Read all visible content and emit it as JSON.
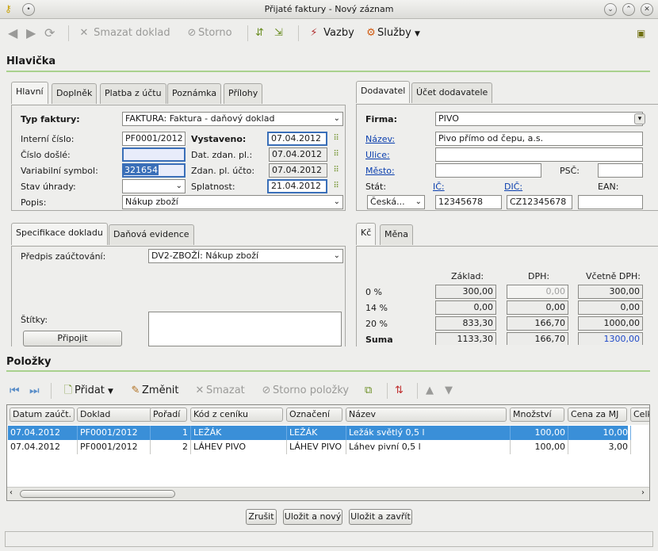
{
  "window": {
    "title": "Přijaté faktury - Nový záznam"
  },
  "toolbar": {
    "delete": "Smazat doklad",
    "storno": "Storno",
    "vazby": "Vazby",
    "sluzby": "Služby"
  },
  "header": {
    "title": "Hlavička",
    "tabs_left": [
      "Hlavní",
      "Doplněk",
      "Platba z účtu",
      "Poznámka",
      "Přílohy"
    ],
    "tabs_right": [
      "Dodavatel",
      "Účet dodavatele"
    ],
    "typ_faktury_label": "Typ faktury:",
    "typ_faktury_value": "FAKTURA: Faktura - daňový doklad",
    "interni_cislo_label": "Interní číslo:",
    "interni_cislo_value": "PF0001/2012",
    "cislo_dosle_label": "Číslo došlé:",
    "cislo_dosle_value": "",
    "variabilni_symbol_label": "Variabilní symbol:",
    "variabilni_symbol_value": "321654",
    "stav_uhrady_label": "Stav úhrady:",
    "stav_uhrady_value": "",
    "popis_label": "Popis:",
    "popis_value": "Nákup zboží",
    "vystaveno_label": "Vystaveno:",
    "vystaveno_value": "07.04.2012",
    "dat_zdan_label": "Dat. zdan. pl.:",
    "dat_zdan_value": "07.04.2012",
    "zdan_ucto_label": "Zdan. pl. účto:",
    "zdan_ucto_value": "07.04.2012",
    "splatnost_label": "Splatnost:",
    "splatnost_value": "21.04.2012"
  },
  "supplier": {
    "firma_label": "Firma:",
    "firma_value": "PIVO",
    "nazev_label": "Název:",
    "nazev_value": "Pivo přímo od čepu, a.s.",
    "ulice_label": "Ulice:",
    "ulice_value": "",
    "mesto_label": "Město:",
    "mesto_value": "",
    "psc_label": "PSČ:",
    "psc_value": "",
    "stat_label": "Stát:",
    "stat_value": "Česká...",
    "ic_label": "IČ:",
    "ic_value": "12345678",
    "dic_label": "DIČ:",
    "dic_value": "CZ12345678",
    "ean_label": "EAN:",
    "ean_value": ""
  },
  "spec": {
    "tabs": [
      "Specifikace dokladu",
      "Daňová evidence"
    ],
    "predpis_label": "Předpis zaúčtování:",
    "predpis_value": "DV2-ZBOŽÍ: Nákup zboží",
    "stitky_label": "Štítky:",
    "pripojit": "Připojit"
  },
  "vat": {
    "tabs": [
      "Kč",
      "Měna"
    ],
    "col_zaklad": "Základ:",
    "col_dph": "DPH:",
    "col_vcetne": "Včetně DPH:",
    "rows": [
      {
        "label": "0 %",
        "zaklad": "300,00",
        "dph": "0,00",
        "vcetne": "300,00"
      },
      {
        "label": "14 %",
        "zaklad": "0,00",
        "dph": "0,00",
        "vcetne": "0,00"
      },
      {
        "label": "20 %",
        "zaklad": "833,30",
        "dph": "166,70",
        "vcetne": "1000,00"
      },
      {
        "label": "Suma",
        "zaklad": "1133,30",
        "dph": "166,70",
        "vcetne": "1300,00"
      }
    ]
  },
  "items": {
    "title": "Položky",
    "pridat": "Přidat",
    "zmenit": "Změnit",
    "smazat": "Smazat",
    "storno_polozky": "Storno položky",
    "columns": [
      "Datum zaúčt.",
      "Doklad",
      "Pořadí",
      "Kód z ceníku",
      "Označení",
      "Název",
      "Množství",
      "Cena za MJ",
      "Celk"
    ],
    "rows": [
      [
        "07.04.2012",
        "PF0001/2012",
        "1",
        "LEŽÁK",
        "LEŽÁK",
        "Ležák světlý 0,5 l",
        "100,00",
        "10,00"
      ],
      [
        "07.04.2012",
        "PF0001/2012",
        "2",
        "LÁHEV PIVO",
        "LÁHEV PIVO",
        "Láhev pivní 0,5 l",
        "100,00",
        "3,00"
      ]
    ]
  },
  "footer": {
    "zrusit": "Zrušit",
    "ulozit_novy": "Uložit a nový",
    "ulozit_zavrit": "Uložit a zavřít"
  },
  "colors": {
    "accent": "#3a8fd8",
    "section_line": "#a9d18e",
    "link": "#0b3fae"
  }
}
